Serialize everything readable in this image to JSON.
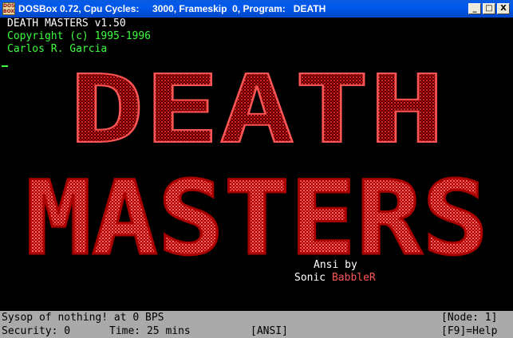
{
  "window": {
    "icon_text": "DOS BOX",
    "title": "DOSBox 0.72, Cpu Cycles:     3000, Frameskip  0, Program:   DEATH",
    "controls": {
      "minimize": "_",
      "maximize": "□",
      "close": "X"
    }
  },
  "terminal": {
    "title": "DEATH MASTERS v1.50",
    "copyright": "Copyright (c) 1995-1996",
    "author": "Carlos R. Garcia",
    "logo_lines": [
      "DEATH",
      "MASTERS"
    ],
    "credit_line1": "Ansi by",
    "credit_prefix": "Sonic ",
    "credit_name": "BabbleR"
  },
  "status": {
    "sysop": "Sysop of nothing! at 0 BPS",
    "node": "[Node: 1]",
    "security": "Security: 0",
    "time": "Time: 25 mins",
    "mode": "[ANSI]",
    "help": "[F9]=Help"
  },
  "colors": {
    "titlebar": "#0058ee",
    "screen_bg": "#000000",
    "header_green": "#3cff3c",
    "logo_red": "#aa0000",
    "logo_bright": "#ff5555",
    "statusbar_bg": "#aaaaaa"
  }
}
